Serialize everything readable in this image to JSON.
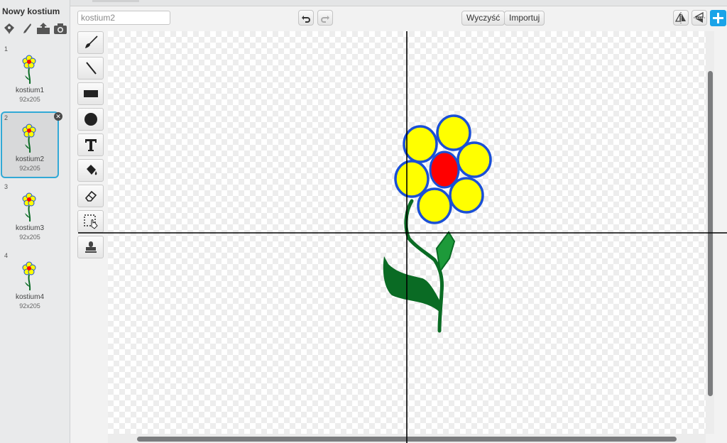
{
  "new_costume": {
    "title": "Nowy kostium",
    "tools": [
      "choose-costume-from-library-icon",
      "paint-new-costume-icon",
      "upload-costume-icon",
      "camera-icon"
    ]
  },
  "costumes": [
    {
      "number": "1",
      "name": "kostium1",
      "size": "92x205",
      "selected": false
    },
    {
      "number": "2",
      "name": "kostium2",
      "size": "92x205",
      "selected": true
    },
    {
      "number": "3",
      "name": "kostium3",
      "size": "92x205",
      "selected": false
    },
    {
      "number": "4",
      "name": "kostium4",
      "size": "92x205",
      "selected": false
    }
  ],
  "editor": {
    "costume_name_value": "kostium2",
    "undo_icon": "undo-icon",
    "redo_icon": "redo-icon",
    "clear_label": "Wyczyść",
    "import_label": "Importuj",
    "flip_horizontal_icon": "flip-horizontal-icon",
    "flip_vertical_icon": "flip-vertical-icon",
    "set_center_icon": "set-costume-center-icon"
  },
  "drawing_tools": [
    "brush-icon",
    "line-icon",
    "rectangle-icon",
    "ellipse-icon",
    "text-icon",
    "fill-bucket-icon",
    "eraser-icon",
    "select-icon",
    "stamp-icon"
  ],
  "colors": {
    "accent": "#1aa3e8",
    "selection_border": "#32a9d6",
    "petal_fill": "#ffff00",
    "petal_stroke": "#1a4fd6",
    "flower_center": "#ff0000",
    "stem": "#0a6b24"
  }
}
